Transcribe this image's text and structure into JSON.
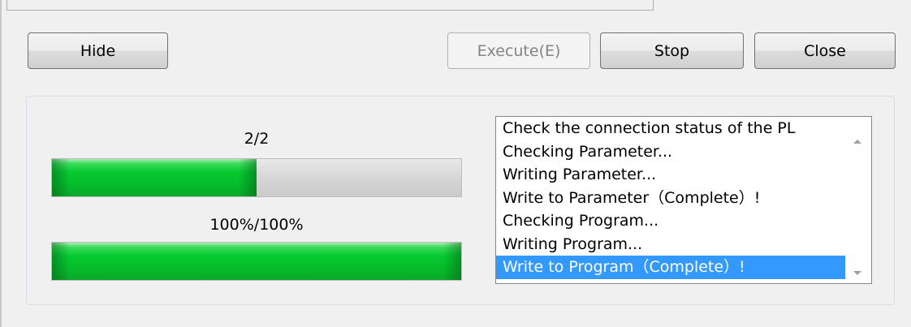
{
  "toolbar": {
    "hide_label": "Hide",
    "execute_label": "Execute(E)",
    "stop_label": "Stop",
    "close_label": "Close"
  },
  "progress": {
    "count_label": "2/2",
    "count_fraction": 0.5,
    "percent_label": "100%/100%",
    "percent_fraction": 1.0
  },
  "log": {
    "items": [
      "Check the connection status of the PL",
      "Checking Parameter...",
      "Writing Parameter...",
      "Write to Parameter（Complete）!",
      "Checking Program...",
      "Writing Program...",
      "Write to Program（Complete）!"
    ],
    "selected_index": 6
  },
  "icons": {
    "scroll_up": "scroll-up-arrow-icon",
    "scroll_down": "scroll-down-arrow-icon"
  },
  "colors": {
    "progress_green": "#06c92f",
    "selection_blue": "#3399ff"
  }
}
